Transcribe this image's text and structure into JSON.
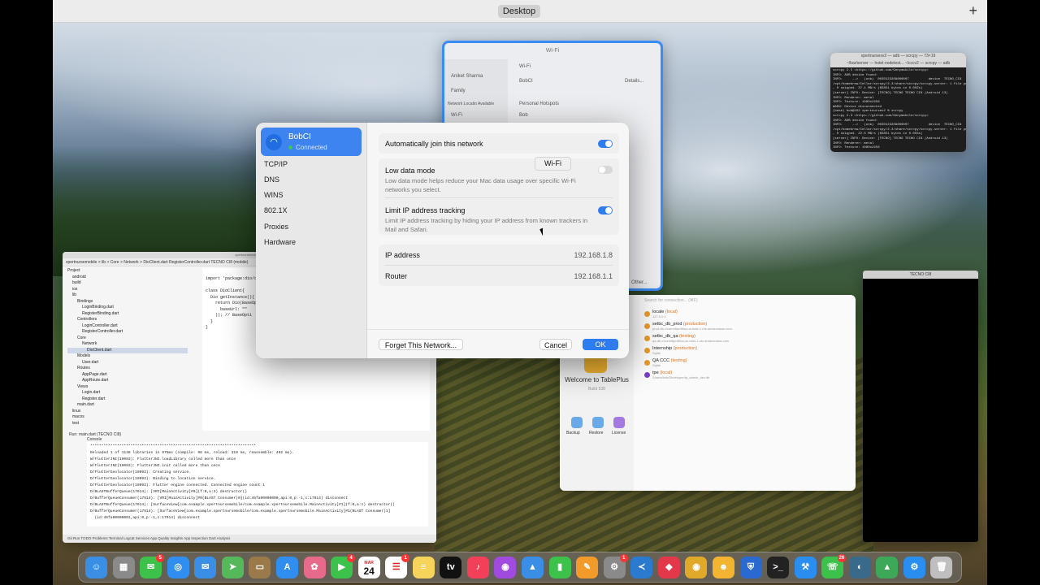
{
  "mission_control": {
    "space_label": "Desktop",
    "add_label": "+"
  },
  "wifi_settings_window": {
    "title": "Wi-Fi",
    "sidebar": [
      "Aniket Sharma",
      "Family",
      "Network Locatio Available",
      "Wi-Fi"
    ],
    "rows": [
      "Wi-Fi",
      "BobCI",
      "Personal Hotspots",
      "Bob",
      "Other..."
    ],
    "details_label": "Details..."
  },
  "terminal": {
    "title": "xpertnursesv2 — adb — scrcpy — 73×19",
    "tabs": "~/bar/server —  hotel-nodetest...   ~/cccv2 — scrcpy — adb",
    "lines": [
      "scrcpy 2.3 <https://github.com/Genymobile/scrcpy>",
      "INFO: ADB device found:",
      "INFO:     -->   (usb)  0035523208000007          device  TECNO_CI8",
      "/opt/homebrew/Cellar/scrcpy/2.3/share/scrcpy/scrcpy-server: 1 file pushed",
      ", 0 skipped. 37.1 MB/s (65851 bytes in 0.002s)",
      "[server] INFO: Device: [TECNO] TECNO TECNO CI8 (Android 13)",
      "INFO: Renderer: metal",
      "INFO: Texture: 1080x2456",
      "WARN: Device disconnected",
      "(base) bob@192 xpertnursev2 % scrcpy",
      "scrcpy 2.3 <https://github.com/Genymobile/scrcpy>",
      "INFO: ADB device found:",
      "INFO:     -->   (usb)  0035523208000007          device  TECNO_CI8",
      "/opt/homebrew/Cellar/scrcpy/2.3/share/scrcpy/scrcpy-server: 1 file pushed",
      ", 0 skipped. 22.5 MB/s (65851 bytes in 0.003s)",
      "[server] INFO: Device: [TECNO] TECNO TECNO CI8 (Android 13)",
      "INFO: Renderer: metal",
      "INFO: Texture: 1080x2456"
    ]
  },
  "phone_mirror": {
    "title": "TECNO CI8"
  },
  "ide": {
    "title": "xpertnursemobile —",
    "toolbar": "xpertnursemobile > lib > Core > Network > DioClient.dart    RegisterController.dart    TECNO CI8 (mobile)",
    "tree": [
      "Project",
      "android",
      "build",
      "ios",
      "lib",
      "Bindings",
      "LoginBinding.dart",
      "RegisterBinding.dart",
      "Controllers",
      "LoginController.dart",
      "RegisterController.dart",
      "Core",
      "Network",
      "DioClient.dart",
      "Models",
      "User.dart",
      "Routes",
      "AppPage.dart",
      "AppRoute.dart",
      "Views",
      "Login.dart",
      "Register.dart",
      "main.dart",
      "linux",
      "macos",
      "test"
    ],
    "code": [
      "import 'package:dio/dio.dart';",
      "",
      "class DioClient{",
      "  Dio getInstance(){",
      "    return Dio(BaseOp",
      "      baseUrl: \"\"",
      "    )); // BaseOpti",
      "  }",
      "}"
    ],
    "run_tab": "Run:    main.dart (TECNO CI8)",
    "console_tab": "Console",
    "console": [
      "**************************************************************************",
      "Reloaded 1 of 1138 libraries in 975ms (compile: 98 ms, reload: 319 ms, reassemble: 492 ms).",
      "W/FlutterJNI(19093): FlutterJNI.loadLibrary called more than once",
      "W/FlutterJNI(19093): FlutterJNI.init called more than once",
      "D/FlutterGeolocator(19093): Creating service.",
      "D/FlutterGeolocator(19093): Binding to location service.",
      "D/FlutterGeolocator(19093): Flutter engine connected. Connected engine count 1",
      "D/BLASTBufferQueue(17914): [VRI[MainActivity]#0](f:0,a:3) destructor()",
      "D/BufferQueueConsumer(17914): [VRI[MainActivity]#0(BLAST Consumer)0](id:45fa00000000,api:0,p:-1,c:17914) disconnect",
      "D/BLASTBufferQueue(17914): [SurfaceView[com.example.xpertnursemobile/com.example.xpertnursemobile.MainActivity]#1](f:0,a:1) destructor()",
      "D/BufferQueueConsumer(17914): [SurfaceView[com.example.xpertnursemobile/com.example.xpertnursemobile.MainActivity]#1(BLAST Consumer)1]",
      "  (id:45fa00000001,api:0,p:-1,c:17914) disconnect"
    ],
    "status": "Git    Run    TODO    Problems    Terminal    Logcat    Services    App Quality Insights    App Inspection    Dart Analysis"
  },
  "tableplus": {
    "search_placeholder": "Search for connection... (⌘F)",
    "welcome": "Welcome to TablePlus",
    "build": "Build 538",
    "actions": [
      "Backup",
      "Restore",
      "License"
    ],
    "connections": [
      {
        "name": "locale",
        "tag": "(local)",
        "host": "127.0.0.1",
        "color": "#e89a2a"
      },
      {
        "name": "setbc_db_prod",
        "tag": "(production)",
        "host": "prod-db.c1semi8prdfrka.us-east-1.rds.amazonaws.com",
        "color": "#e89a2a"
      },
      {
        "name": "setbc_db_qa",
        "tag": "(testing)",
        "host": "qa-db.c1semi8prdfrka.us-east-1.rds.amazonaws.com",
        "color": "#e89a2a"
      },
      {
        "name": "Internship",
        "tag": "(production)",
        "host": "Sqlite",
        "color": "#e89a2a"
      },
      {
        "name": "QA CCC",
        "tag": "(testing)",
        "host": "Sqlite",
        "color": "#e89a2a"
      },
      {
        "name": "tpe",
        "tag": "(local)",
        "host": "/Users/bob/Developer/tp_admin_dev.db",
        "color": "#7a3cc8"
      }
    ]
  },
  "dialog": {
    "network_name": "BobCI",
    "network_status": "Connected",
    "sidebar_items": [
      "TCP/IP",
      "DNS",
      "WINS",
      "802.1X",
      "Proxies",
      "Hardware"
    ],
    "auto_join_label": "Automatically join this network",
    "auto_join_on": true,
    "low_data_label": "Low data mode",
    "low_data_desc": "Low data mode helps reduce your Mac data usage over specific Wi-Fi networks you select.",
    "low_data_on": false,
    "limit_ip_label": "Limit IP address tracking",
    "limit_ip_desc": "Limit IP address tracking by hiding your IP address from known trackers in Mail and Safari.",
    "limit_ip_on": true,
    "tooltip": "Wi-Fi",
    "ip_label": "IP address",
    "ip_value": "192.168.1.8",
    "router_label": "Router",
    "router_value": "192.168.1.1",
    "forget_label": "Forget This Network...",
    "cancel_label": "Cancel",
    "ok_label": "OK",
    "accent": "#2e7cf0"
  },
  "dock": {
    "apps": [
      {
        "name": "finder-icon",
        "glyph": "☺",
        "color": "#3a8ee6"
      },
      {
        "name": "launchpad-icon",
        "glyph": "▦",
        "color": "#8a8a8a"
      },
      {
        "name": "messages-icon",
        "glyph": "✉",
        "color": "#3cc24a",
        "badge": "5"
      },
      {
        "name": "safari-icon",
        "glyph": "◎",
        "color": "#2f8ef0"
      },
      {
        "name": "mail-icon",
        "glyph": "✉",
        "color": "#3a8ee6"
      },
      {
        "name": "maps-icon",
        "glyph": "➤",
        "color": "#55b85a"
      },
      {
        "name": "wallet-icon",
        "glyph": "▭",
        "color": "#9a7a4a"
      },
      {
        "name": "app-store-icon",
        "glyph": "A",
        "color": "#2f8ef0"
      },
      {
        "name": "photos-icon",
        "glyph": "✿",
        "color": "#e86a8a"
      },
      {
        "name": "facetime-icon",
        "glyph": "▶",
        "color": "#3cc24a",
        "badge": "4"
      },
      {
        "name": "calendar-icon",
        "glyph": "24",
        "color": "#ffffff",
        "label_top": "MAR"
      },
      {
        "name": "reminders-icon",
        "glyph": "☰",
        "color": "#ffffff",
        "badge": "1"
      },
      {
        "name": "notes-icon",
        "glyph": "≡",
        "color": "#f6d35a"
      },
      {
        "name": "apple-tv-icon",
        "glyph": "tv",
        "color": "#111111"
      },
      {
        "name": "music-icon",
        "glyph": "♪",
        "color": "#f2405a"
      },
      {
        "name": "podcasts-icon",
        "glyph": "◉",
        "color": "#a04ae0"
      },
      {
        "name": "keynote-icon",
        "glyph": "▲",
        "color": "#3a8ee6"
      },
      {
        "name": "numbers-icon",
        "glyph": "▮",
        "color": "#3cc24a"
      },
      {
        "name": "pages-icon",
        "glyph": "✎",
        "color": "#f29a2a"
      },
      {
        "name": "system-settings-icon",
        "glyph": "⚙",
        "color": "#8a8a8a",
        "badge": "1"
      },
      {
        "name": "vscode-icon",
        "glyph": "≺",
        "color": "#2a7ad0"
      },
      {
        "name": "git-client-icon",
        "glyph": "◆",
        "color": "#e2384a"
      },
      {
        "name": "chrome-icon",
        "glyph": "◉",
        "color": "#e0a92a"
      },
      {
        "name": "tableplus-icon",
        "glyph": "☻",
        "color": "#f2b431"
      },
      {
        "name": "vpn-icon",
        "glyph": "⛨",
        "color": "#2a6ad0"
      },
      {
        "name": "terminal-icon",
        "glyph": ">_",
        "color": "#222222"
      },
      {
        "name": "xcode-icon",
        "glyph": "⚒",
        "color": "#2a8ef0"
      },
      {
        "name": "whatsapp-icon",
        "glyph": "☏",
        "color": "#3cc24a",
        "badge": "26"
      },
      {
        "name": "proxyman-icon",
        "glyph": "◐",
        "color": "#3a6a8a"
      },
      {
        "name": "android-studio-icon",
        "glyph": "▲",
        "color": "#3ca858"
      },
      {
        "name": "simulator-icon",
        "glyph": "⚙",
        "color": "#2a8ef0"
      },
      {
        "name": "trash-icon",
        "glyph": "🗑",
        "color": "#bfbfbf"
      }
    ]
  }
}
